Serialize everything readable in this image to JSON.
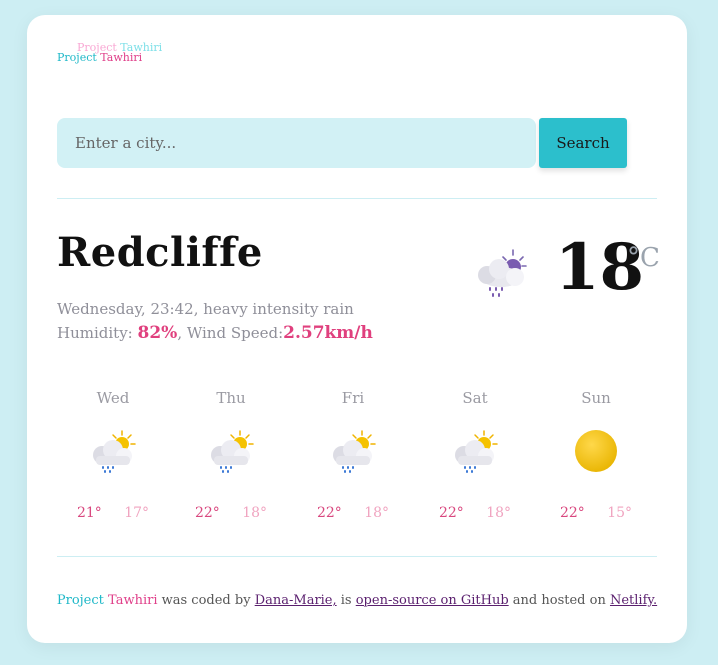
{
  "logo": {
    "shadow_word1": "Project",
    "shadow_word2": "Tawhiri",
    "word1": "Project",
    "word2": "Tawhiri"
  },
  "search": {
    "placeholder": "Enter a city...",
    "button_label": "Search"
  },
  "current": {
    "city": "Redcliffe",
    "date_desc": "Wednesday, 23:42, heavy intensity rain",
    "humidity_label": "Humidity:",
    "humidity_value": "82%",
    "wind_label": ", Wind Speed:",
    "wind_value": "2.57km/h",
    "temperature": "18",
    "unit": "°C",
    "icon": "night-cloud-rain-icon"
  },
  "forecast": [
    {
      "day": "Wed",
      "max": "21°",
      "min": "17°",
      "icon": "sun-cloud-rain-icon"
    },
    {
      "day": "Thu",
      "max": "22°",
      "min": "18°",
      "icon": "sun-cloud-rain-icon"
    },
    {
      "day": "Fri",
      "max": "22°",
      "min": "18°",
      "icon": "sun-cloud-rain-icon"
    },
    {
      "day": "Sat",
      "max": "22°",
      "min": "18°",
      "icon": "sun-cloud-rain-icon"
    },
    {
      "day": "Sun",
      "max": "22°",
      "min": "15°",
      "icon": "sun-icon"
    }
  ],
  "footer": {
    "brand1": "Project",
    "brand2": "Tawhiri",
    "text1": " was coded by ",
    "author_link": "Dana-Marie,",
    "text2": " is ",
    "github_link": "open-source on GitHub",
    "text3": " and hosted on ",
    "netlify_link": "Netlify."
  },
  "colors": {
    "background": "#cdeef3",
    "accent_teal": "#2cbfcc",
    "accent_pink": "#e0407e"
  }
}
